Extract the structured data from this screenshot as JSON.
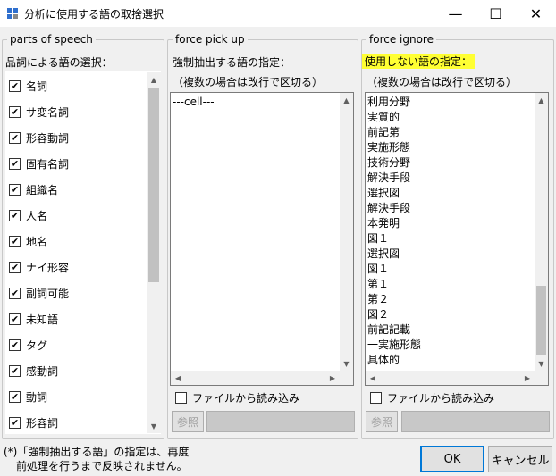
{
  "window": {
    "title": "分析に使用する語の取捨選択",
    "minimize_glyph": "—",
    "maximize_glyph": "☐",
    "close_glyph": "✕"
  },
  "pos_panel": {
    "legend": "parts of speech",
    "label": "品詞による語の選択：",
    "items": [
      {
        "label": "名詞",
        "checked": "✔"
      },
      {
        "label": "サ変名詞",
        "checked": "✔"
      },
      {
        "label": "形容動詞",
        "checked": "✔"
      },
      {
        "label": "固有名詞",
        "checked": "✔"
      },
      {
        "label": "組織名",
        "checked": "✔"
      },
      {
        "label": "人名",
        "checked": "✔"
      },
      {
        "label": "地名",
        "checked": "✔"
      },
      {
        "label": "ナイ形容",
        "checked": "✔"
      },
      {
        "label": "副詞可能",
        "checked": "✔"
      },
      {
        "label": "未知語",
        "checked": "✔"
      },
      {
        "label": "タグ",
        "checked": "✔"
      },
      {
        "label": "感動詞",
        "checked": "✔"
      },
      {
        "label": "動詞",
        "checked": "✔"
      },
      {
        "label": "形容詞",
        "checked": "✔"
      }
    ]
  },
  "pickup_panel": {
    "legend": "force pick up",
    "label1": "強制抽出する語の指定：",
    "label2": "（複数の場合は改行で区切る）",
    "lines": [
      "---cell---"
    ],
    "file_label": "ファイルから読み込み",
    "browse_label": "参照"
  },
  "ignore_panel": {
    "legend": "force ignore",
    "label1": "使用しない語の指定：",
    "label2": "（複数の場合は改行で区切る）",
    "highlight_color": "#ffff33",
    "lines": [
      "利用分野",
      "実質的",
      "前記第",
      "実施形態",
      "技術分野",
      "解決手段",
      "選択図",
      "解決手段",
      "本発明",
      "図１",
      "選択図",
      "図１",
      "第１",
      "第２",
      "図２",
      "前記記載",
      "一実施形態",
      "具体的"
    ],
    "file_label": "ファイルから読み込み",
    "browse_label": "参照"
  },
  "footer": {
    "note_line1": "(*)「強制抽出する語」の指定は、再度",
    "note_line2": "前処理を行うまで反映されません。",
    "ok_label": "OK",
    "cancel_label": "キャンセル"
  },
  "scroll_glyphs": {
    "up": "▲",
    "down": "▼",
    "left": "◀",
    "right": "▶"
  }
}
